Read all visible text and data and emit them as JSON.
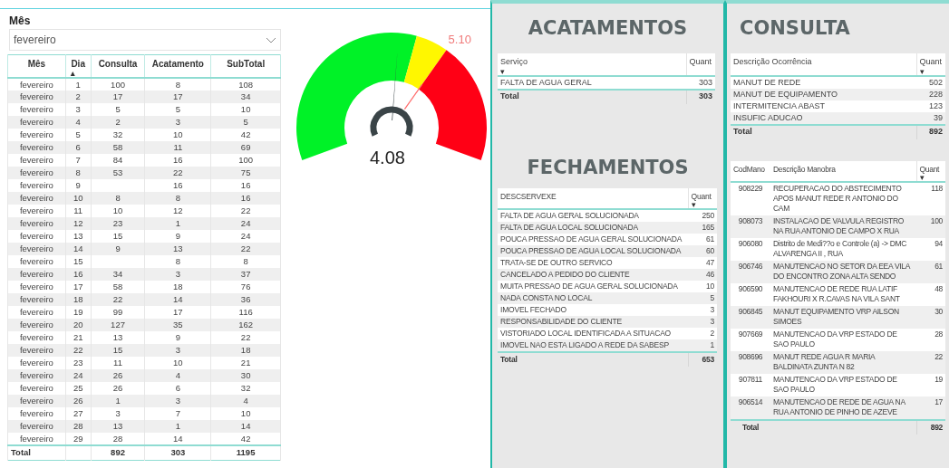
{
  "slicer": {
    "label": "Mês",
    "value": "fevereiro"
  },
  "daily_table": {
    "columns": [
      {
        "label": "Mês"
      },
      {
        "label": "Dia",
        "sort_icon": "▴"
      },
      {
        "label": "Consulta"
      },
      {
        "label": "Acatamento"
      },
      {
        "label": "SubTotal"
      }
    ],
    "rows": [
      [
        "fevereiro",
        "1",
        "100",
        "8",
        "108"
      ],
      [
        "fevereiro",
        "2",
        "17",
        "17",
        "34"
      ],
      [
        "fevereiro",
        "3",
        "5",
        "5",
        "10"
      ],
      [
        "fevereiro",
        "4",
        "2",
        "3",
        "5"
      ],
      [
        "fevereiro",
        "5",
        "32",
        "10",
        "42"
      ],
      [
        "fevereiro",
        "6",
        "58",
        "11",
        "69"
      ],
      [
        "fevereiro",
        "7",
        "84",
        "16",
        "100"
      ],
      [
        "fevereiro",
        "8",
        "53",
        "22",
        "75"
      ],
      [
        "fevereiro",
        "9",
        null,
        "16",
        "16"
      ],
      [
        "fevereiro",
        "10",
        "8",
        "8",
        "16"
      ],
      [
        "fevereiro",
        "11",
        "10",
        "12",
        "22"
      ],
      [
        "fevereiro",
        "12",
        "23",
        "1",
        "24"
      ],
      [
        "fevereiro",
        "13",
        "15",
        "9",
        "24"
      ],
      [
        "fevereiro",
        "14",
        "9",
        "13",
        "22"
      ],
      [
        "fevereiro",
        "15",
        null,
        "8",
        "8"
      ],
      [
        "fevereiro",
        "16",
        "34",
        "3",
        "37"
      ],
      [
        "fevereiro",
        "17",
        "58",
        "18",
        "76"
      ],
      [
        "fevereiro",
        "18",
        "22",
        "14",
        "36"
      ],
      [
        "fevereiro",
        "19",
        "99",
        "17",
        "116"
      ],
      [
        "fevereiro",
        "20",
        "127",
        "35",
        "162"
      ],
      [
        "fevereiro",
        "21",
        "13",
        "9",
        "22"
      ],
      [
        "fevereiro",
        "22",
        "15",
        "3",
        "18"
      ],
      [
        "fevereiro",
        "23",
        "11",
        "10",
        "21"
      ],
      [
        "fevereiro",
        "24",
        "26",
        "4",
        "30"
      ],
      [
        "fevereiro",
        "25",
        "26",
        "6",
        "32"
      ],
      [
        "fevereiro",
        "26",
        "1",
        "3",
        "4"
      ],
      [
        "fevereiro",
        "27",
        "3",
        "7",
        "10"
      ],
      [
        "fevereiro",
        "28",
        "13",
        "1",
        "14"
      ],
      [
        "fevereiro",
        "29",
        "28",
        "14",
        "42"
      ]
    ],
    "total": {
      "label": "Total",
      "values": [
        "892",
        "303",
        "1195"
      ]
    }
  },
  "gauge": {
    "value": "4.08",
    "target": {
      "label": "5.10"
    }
  },
  "acatamentos": {
    "title": "ACATAMENTOS",
    "columns": [
      {
        "label": "Serviço",
        "sort_icon": "▾"
      },
      {
        "label": "Quant"
      }
    ],
    "rows": [
      [
        "FALTA DE AGUA GERAL",
        "303"
      ]
    ],
    "total": {
      "label": "Total",
      "values": [
        "303"
      ]
    }
  },
  "fechamentos": {
    "title": "FECHAMENTOS",
    "columns": [
      {
        "label": "DESCSERVEXE"
      },
      {
        "label": "Quant",
        "sort_icon": "▾"
      }
    ],
    "rows": [
      [
        "FALTA DE AGUA GERAL SOLUCIONADA",
        "250"
      ],
      [
        "FALTA DE AGUA LOCAL SOLUCIONADA",
        "165"
      ],
      [
        "POUCA PRESSAO DE AGUA GERAL SOLUCIONADA",
        "61"
      ],
      [
        "POUCA PRESSAO DE AGUA LOCAL SOLUCIONADA",
        "60"
      ],
      [
        "TRATA-SE DE OUTRO SERVICO",
        "47"
      ],
      [
        "CANCELADO A PEDIDO DO CLIENTE",
        "46"
      ],
      [
        "MUITA PRESSAO DE AGUA GERAL SOLUCIONADA",
        "10"
      ],
      [
        "NADA CONSTA NO LOCAL",
        "5"
      ],
      [
        "IMOVEL FECHADO",
        "3"
      ],
      [
        "RESPONSABILIDADE DO CLIENTE",
        "3"
      ],
      [
        "VISTORIADO LOCAL IDENTIFICADA A SITUACAO",
        "2"
      ],
      [
        "IMOVEL NAO ESTA LIGADO A REDE DA SABESP",
        "1"
      ]
    ],
    "total": {
      "label": "Total",
      "values": [
        "653"
      ]
    }
  },
  "consulta": {
    "title": "CONSULTA",
    "occurrences": {
      "columns": [
        {
          "label": "Descrição Ocorrência"
        },
        {
          "label": "Quant",
          "sort_icon": "▾"
        }
      ],
      "rows": [
        [
          "MANUT DE REDE",
          "502"
        ],
        [
          "MANUT DE EQUIPAMENTO",
          "228"
        ],
        [
          "INTERMITENCIA ABAST",
          "123"
        ],
        [
          "INSUFIC ADUCAO",
          "39"
        ]
      ],
      "total": {
        "label": "Total",
        "values": [
          "892"
        ]
      }
    },
    "manobras": {
      "columns": [
        {
          "label": "CodMano"
        },
        {
          "label": "Descrição Manobra"
        },
        {
          "label": "Quant",
          "sort_icon": "▾"
        }
      ],
      "rows": [
        [
          "908229",
          "RECUPERACAO DO ABSTECIMENTO APOS MANUT REDE R ANTONIO DO CAM",
          "118"
        ],
        [
          "908073",
          "INSTALACAO DE VALVULA REGISTRO NA RUA ANTONIO DE CAMPO X RUA",
          "100"
        ],
        [
          "906080",
          "Distrito de Medi??o e Controle (a) -> DMC ALVARENGA II , RUA",
          "94"
        ],
        [
          "906746",
          "MANUTENCAO NO SETOR DA EEA VILA DO ENCONTRO ZONA ALTA SENDO",
          "61"
        ],
        [
          "906590",
          "MANUTENCAO DE REDE RUA LATIF FAKHOURI X R.CAVAS NA VILA SANT",
          "48"
        ],
        [
          "906845",
          "MANUT EQUIPAMENTO VRP AILSON SIMOES",
          "30"
        ],
        [
          "907669",
          "MANUTENCAO DA VRP ESTADO DE SAO PAULO",
          "28"
        ],
        [
          "908696",
          "MANUT REDE AGUA R MARIA BALDINATA ZUNTA N 82",
          "22"
        ],
        [
          "907811",
          "MANUTENCAO DA VRP ESTADO DE SAO PAULO",
          "19"
        ],
        [
          "906514",
          "MANUTENCAO DE REDE DE AGUA NA RUA ANTONIO DE PINHO DE AZEVE",
          "17"
        ]
      ],
      "total": {
        "label": "Total",
        "values": [
          "892"
        ]
      }
    }
  }
}
